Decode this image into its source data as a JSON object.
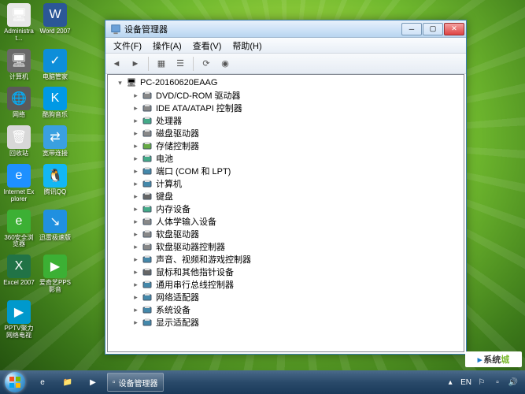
{
  "desktop": {
    "icons": [
      {
        "label": "Administrat...",
        "color": "#e8e8e8",
        "glyph": "🖥"
      },
      {
        "label": "Word 2007",
        "color": "#2b5797",
        "glyph": "W"
      },
      {
        "label": "计算机",
        "color": "#6a6a6a",
        "glyph": "🖥"
      },
      {
        "label": "电脑管家",
        "color": "#0d8ed9",
        "glyph": "✓"
      },
      {
        "label": "网络",
        "color": "#5a5a5a",
        "glyph": "🌐"
      },
      {
        "label": "酷狗音乐",
        "color": "#0099e5",
        "glyph": "K"
      },
      {
        "label": "回收站",
        "color": "#d8d8d8",
        "glyph": "🗑"
      },
      {
        "label": "宽带连接",
        "color": "#3aa0e0",
        "glyph": "⇄"
      },
      {
        "label": "Internet Explorer",
        "color": "#1e90ff",
        "glyph": "e"
      },
      {
        "label": "腾讯QQ",
        "color": "#12b7f5",
        "glyph": "🐧"
      },
      {
        "label": "360安全浏览器",
        "color": "#3cb034",
        "glyph": "e"
      },
      {
        "label": "迅雷极速版",
        "color": "#2090e0",
        "glyph": "↘"
      },
      {
        "label": "Excel 2007",
        "color": "#217346",
        "glyph": "X"
      },
      {
        "label": "爱奇艺PPS影音",
        "color": "#3cb034",
        "glyph": "▶"
      },
      {
        "label": "PPTV聚力 网络电视",
        "color": "#0099cc",
        "glyph": "▶"
      }
    ]
  },
  "window": {
    "title": "设备管理器",
    "menus": [
      "文件(F)",
      "操作(A)",
      "查看(V)",
      "帮助(H)"
    ],
    "root": "PC-20160620EAAG",
    "nodes": [
      {
        "label": "DVD/CD-ROM 驱动器",
        "iconColor": "#888"
      },
      {
        "label": "IDE ATA/ATAPI 控制器",
        "iconColor": "#888"
      },
      {
        "label": "处理器",
        "iconColor": "#4a8"
      },
      {
        "label": "磁盘驱动器",
        "iconColor": "#888"
      },
      {
        "label": "存储控制器",
        "iconColor": "#6a4"
      },
      {
        "label": "电池",
        "iconColor": "#4a8"
      },
      {
        "label": "端口 (COM 和 LPT)",
        "iconColor": "#48a"
      },
      {
        "label": "计算机",
        "iconColor": "#48a"
      },
      {
        "label": "键盘",
        "iconColor": "#666"
      },
      {
        "label": "内存设备",
        "iconColor": "#4a8"
      },
      {
        "label": "人体学输入设备",
        "iconColor": "#888"
      },
      {
        "label": "软盘驱动器",
        "iconColor": "#888"
      },
      {
        "label": "软盘驱动器控制器",
        "iconColor": "#888"
      },
      {
        "label": "声音、视频和游戏控制器",
        "iconColor": "#48a"
      },
      {
        "label": "鼠标和其他指针设备",
        "iconColor": "#666"
      },
      {
        "label": "通用串行总线控制器",
        "iconColor": "#48a"
      },
      {
        "label": "网络适配器",
        "iconColor": "#48a"
      },
      {
        "label": "系统设备",
        "iconColor": "#48a"
      },
      {
        "label": "显示适配器",
        "iconColor": "#48a"
      }
    ]
  },
  "taskbar": {
    "active_task": "设备管理器",
    "tray": {
      "lang": "EN",
      "time": ""
    }
  },
  "watermark": "系统"
}
